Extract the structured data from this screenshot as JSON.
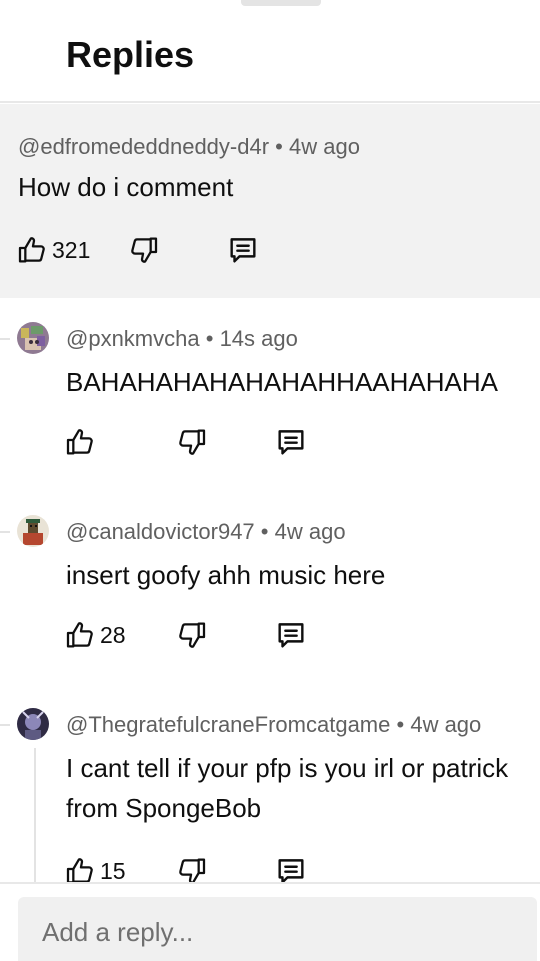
{
  "header": {
    "title": "Replies"
  },
  "parent_comment": {
    "author": "@edfromededdneddy-d4r",
    "time": "4w ago",
    "text": "How do i comment",
    "likes": "321"
  },
  "replies": [
    {
      "author": "@pxnkmvcha",
      "time": "14s ago",
      "text": [
        "BAHAHAHAHAHAHAHHAAHAHAHA"
      ],
      "likes": ""
    },
    {
      "author": "@canaldovictor947",
      "time": "4w ago",
      "text": [
        "insert goofy ahh music here"
      ],
      "likes": "28"
    },
    {
      "author": "@ThegratefulcraneFromcatgame",
      "time": "4w ago",
      "text": [
        "I cant tell if your pfp is you irl or patrick",
        "from SpongeBob"
      ],
      "likes": "15"
    }
  ],
  "reply_bar": {
    "placeholder": "Add a reply..."
  },
  "icons": {
    "like": "thumbs-up-icon",
    "dislike": "thumbs-down-icon",
    "reply": "comment-icon"
  }
}
